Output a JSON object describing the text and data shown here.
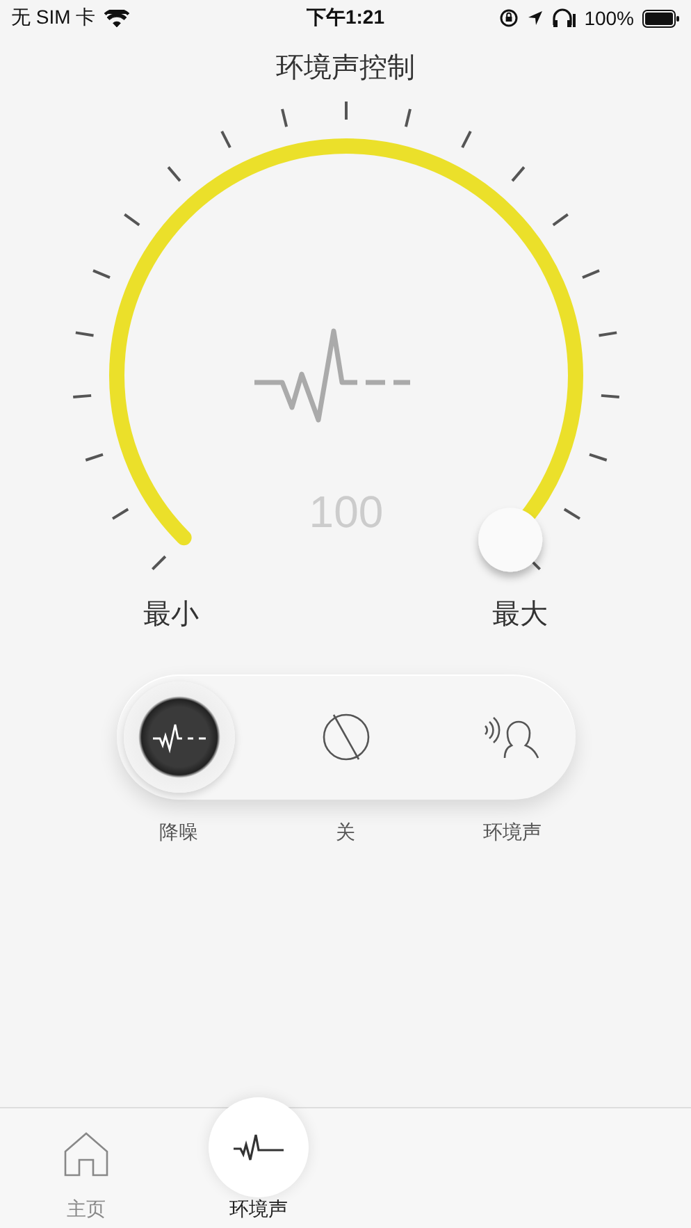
{
  "status_bar": {
    "carrier": "无 SIM 卡",
    "time": "下午1:21",
    "battery": "100%"
  },
  "title": "环境声控制",
  "dial": {
    "value": "100",
    "min_label": "最小",
    "max_label": "最大"
  },
  "modes": [
    {
      "kind": "noise",
      "label": "降噪",
      "selected": true
    },
    {
      "kind": "off",
      "label": "关",
      "selected": false
    },
    {
      "kind": "ambient",
      "label": "环境声",
      "selected": false
    }
  ],
  "tabs": [
    {
      "kind": "home",
      "label": "主页",
      "selected": false
    },
    {
      "kind": "ambient",
      "label": "环境声",
      "selected": true
    }
  ]
}
